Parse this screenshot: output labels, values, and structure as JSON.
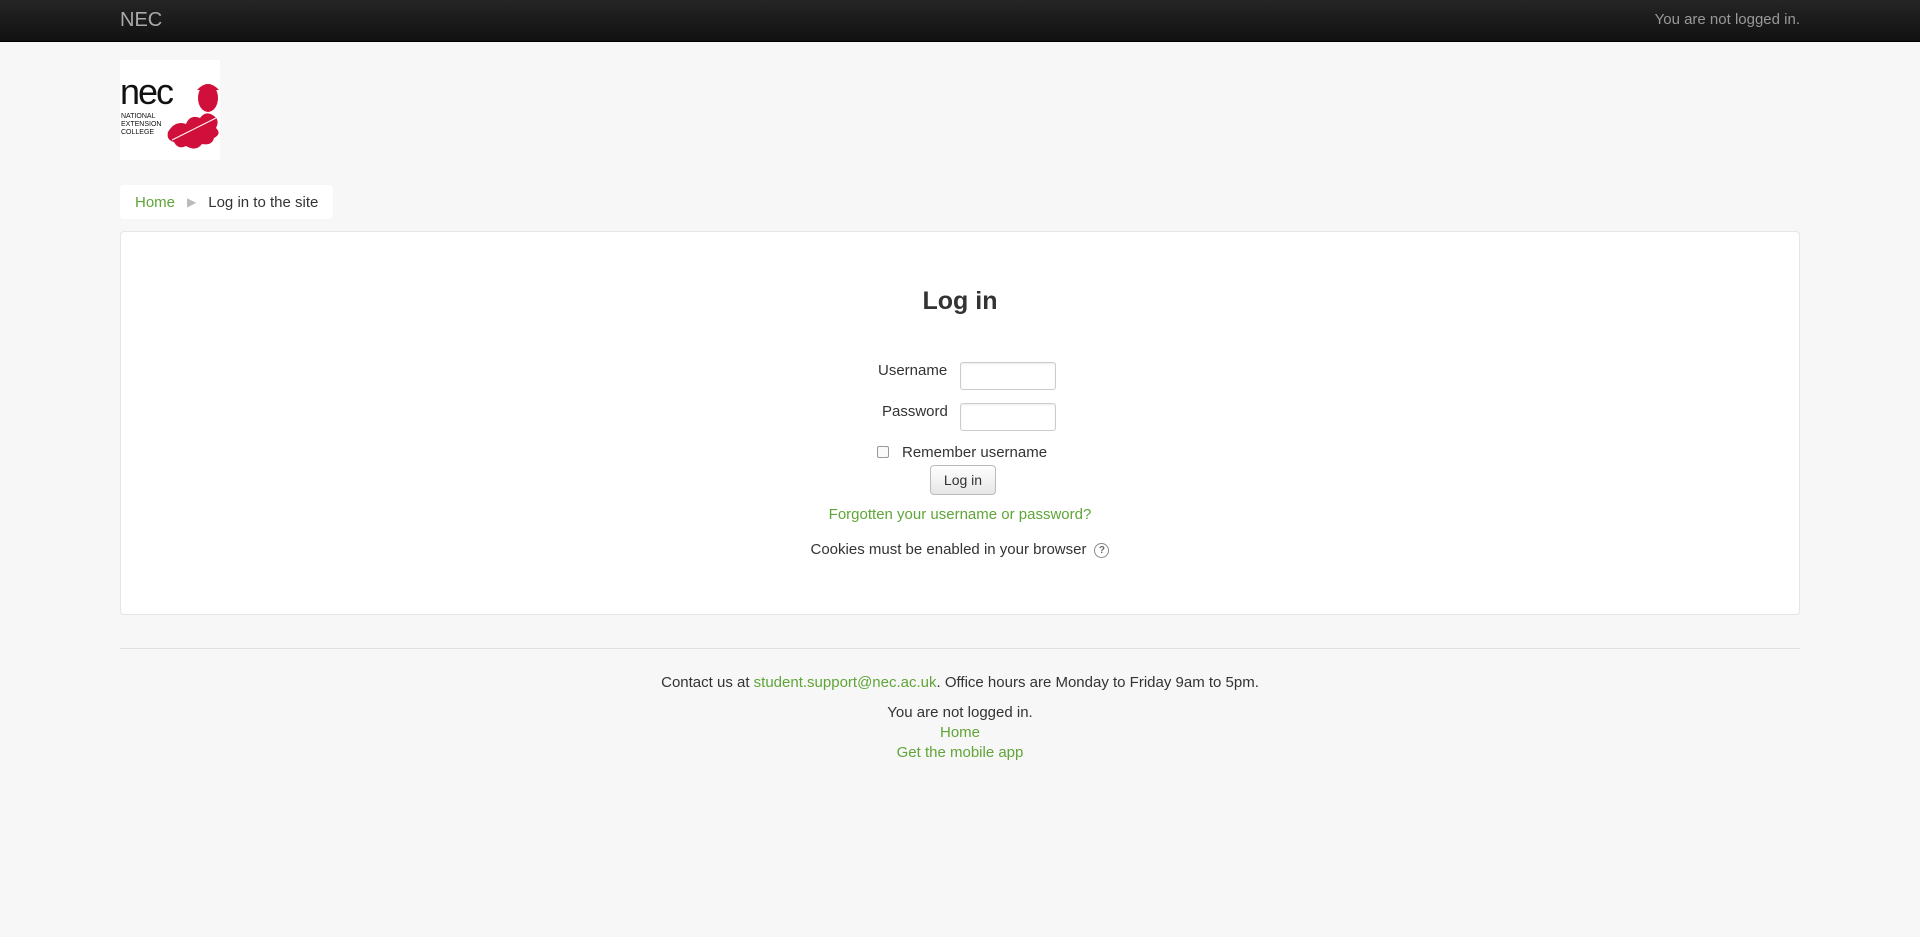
{
  "navbar": {
    "brand": "NEC",
    "login_status": "You are not logged in."
  },
  "logo": {
    "wordmark": "nec",
    "subtext_lines": [
      "NATIONAL",
      "EXTENSION",
      "COLLEGE"
    ],
    "accent_color": "#d0103a"
  },
  "breadcrumb": {
    "home": "Home",
    "separator": "▶",
    "current": "Log in to the site"
  },
  "login": {
    "title": "Log in",
    "username_label": "Username",
    "username_value": "",
    "password_label": "Password",
    "password_value": "",
    "remember_label": "Remember username",
    "remember_checked": false,
    "submit_label": "Log in",
    "forgot_link": "Forgotten your username or password?",
    "cookies_note": "Cookies must be enabled in your browser",
    "help_icon": "question-circle-icon"
  },
  "footer": {
    "contact_prefix": "Contact us at ",
    "contact_email": "student.support@nec.ac.uk",
    "contact_suffix": ". Office hours are Monday to Friday 9am to 5pm.",
    "login_status": "You are not logged in.",
    "home_link": "Home",
    "mobile_app_link": "Get the mobile app"
  },
  "colors": {
    "link": "#5fa537",
    "navbar": "#1c1c1c",
    "background": "#f7f7f7"
  }
}
